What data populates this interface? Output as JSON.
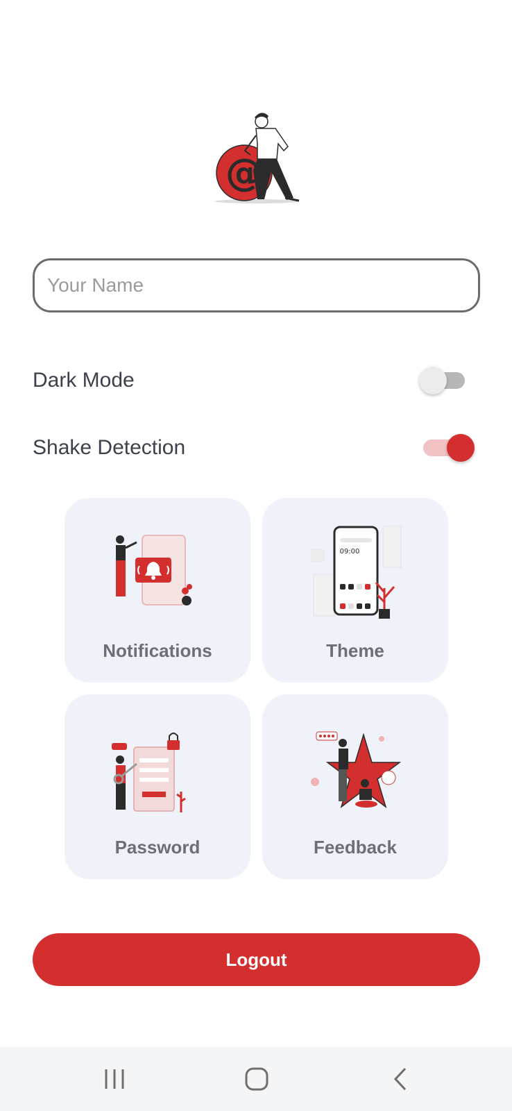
{
  "profile": {
    "name_placeholder": "Your Name",
    "name_value": ""
  },
  "settings": {
    "dark_mode": {
      "label": "Dark Mode",
      "enabled": false
    },
    "shake_detection": {
      "label": "Shake Detection",
      "enabled": true
    }
  },
  "cards": [
    {
      "label": "Notifications",
      "icon": "notifications-illustration"
    },
    {
      "label": "Theme",
      "icon": "theme-illustration"
    },
    {
      "label": "Password",
      "icon": "password-illustration"
    },
    {
      "label": "Feedback",
      "icon": "feedback-illustration"
    }
  ],
  "logout_label": "Logout",
  "theme_phone_time": "09:00",
  "colors": {
    "accent": "#d32f2f",
    "card_bg": "#eff2f8",
    "text": "#3c414c"
  },
  "navbar": {
    "recents_icon": "recents-icon",
    "home_icon": "home-icon",
    "back_icon": "back-icon"
  }
}
